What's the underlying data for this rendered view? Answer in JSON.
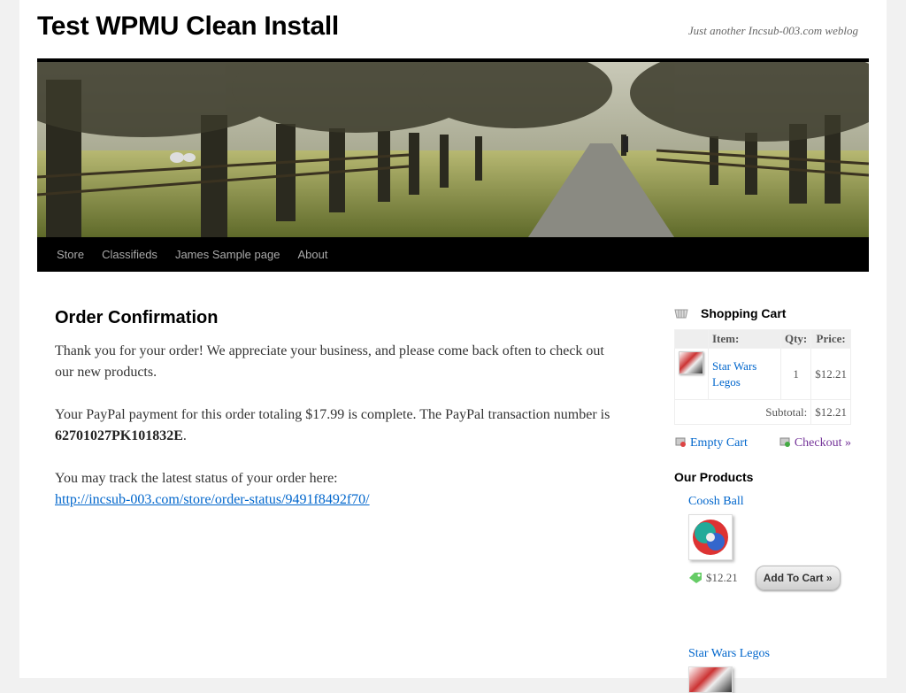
{
  "site": {
    "title": "Test WPMU Clean Install",
    "description": "Just another Incsub-003.com weblog"
  },
  "nav": [
    "Store",
    "Classifieds",
    "James Sample page",
    "About"
  ],
  "content": {
    "heading": "Order Confirmation",
    "thanks": "Thank you for your order! We appreciate your business, and please come back often to check out our new products.",
    "paypal_text": "Your PayPal payment for this order totaling $17.99 is complete. The PayPal transaction number is",
    "transaction": "62701027PK101832E",
    "period": ".",
    "track_text": "You may track the latest status of your order here:",
    "track_link": "http://incsub-003.com/store/order-status/9491f8492f70/"
  },
  "cart": {
    "title": "Shopping Cart",
    "headers": [
      "Item:",
      "Qty:",
      "Price:"
    ],
    "items": [
      {
        "name": "Star Wars Legos",
        "qty": "1",
        "price": "$12.21"
      }
    ],
    "subtotal_label": "Subtotal:",
    "subtotal": "$12.21",
    "empty_label": "Empty Cart",
    "checkout_label": "Checkout »"
  },
  "products": {
    "title": "Our Products",
    "items": [
      {
        "name": "Coosh Ball",
        "price": "$12.21",
        "button": "Add To Cart »"
      },
      {
        "name": "Star Wars Legos"
      }
    ]
  },
  "colors": {
    "link": "#0066cc",
    "visited": "#743399",
    "nav_bg": "#000000"
  }
}
